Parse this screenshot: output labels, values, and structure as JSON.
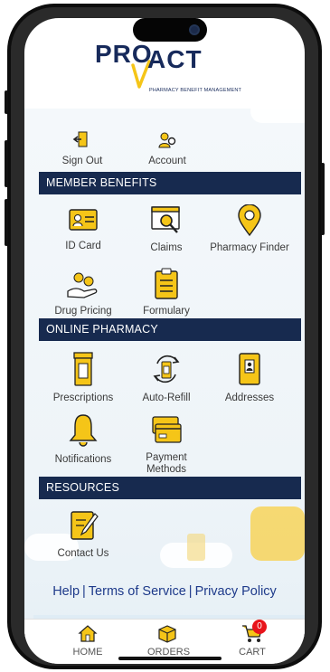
{
  "brand": {
    "name_left": "PRO",
    "name_right": "ACT",
    "tagline": "PHARMACY BENEFIT MANAGEMENT"
  },
  "colors": {
    "navy": "#172a4f",
    "accent_yellow": "#f5c518",
    "link_blue": "#1e3a8a",
    "badge_red": "#e8141b"
  },
  "top_actions": [
    {
      "label": "Sign Out",
      "icon": "sign-out-icon"
    },
    {
      "label": "Account",
      "icon": "account-gear-icon"
    }
  ],
  "sections": {
    "member_benefits": {
      "title": "MEMBER BENEFITS",
      "items": [
        {
          "label": "ID Card",
          "icon": "id-card-icon"
        },
        {
          "label": "Claims",
          "icon": "claims-search-icon"
        },
        {
          "label": "Pharmacy Finder",
          "icon": "map-pin-icon"
        },
        {
          "label": "Drug Pricing",
          "icon": "hand-coins-icon"
        },
        {
          "label": "Formulary",
          "icon": "clipboard-icon"
        }
      ]
    },
    "online_pharmacy": {
      "title": "ONLINE PHARMACY",
      "items": [
        {
          "label": "Prescriptions",
          "icon": "pill-bottle-icon"
        },
        {
          "label": "Auto-Refill",
          "icon": "refill-cycle-icon"
        },
        {
          "label": "Addresses",
          "icon": "address-book-icon"
        },
        {
          "label": "Notifications",
          "icon": "bell-icon"
        },
        {
          "label": "Payment",
          "label2": "Methods",
          "icon": "cards-icon"
        }
      ]
    },
    "resources": {
      "title": "RESOURCES",
      "items": [
        {
          "label": "Contact Us",
          "icon": "contact-note-icon"
        }
      ]
    }
  },
  "footer_links": [
    "Help",
    "Terms of Service",
    "Privacy Policy"
  ],
  "tabbar": {
    "home": "HOME",
    "orders": "ORDERS",
    "cart": "CART",
    "cart_count": "0"
  }
}
